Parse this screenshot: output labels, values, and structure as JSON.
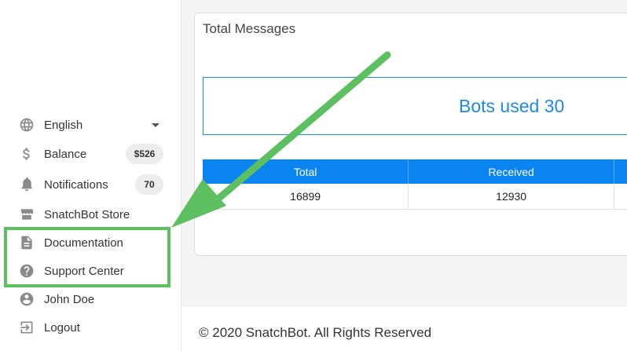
{
  "sidebar": {
    "language": {
      "label": "English",
      "icon": "globe-icon"
    },
    "balance": {
      "label": "Balance",
      "badge": "$526",
      "icon": "dollar-icon"
    },
    "notifications": {
      "label": "Notifications",
      "badge": "70",
      "icon": "bell-icon"
    },
    "store": {
      "label": "SnatchBot Store",
      "icon": "store-icon"
    },
    "documentation": {
      "label": "Documentation",
      "icon": "document-icon"
    },
    "support": {
      "label": "Support Center",
      "icon": "help-circle-icon"
    },
    "user": {
      "label": "John Doe",
      "icon": "user-icon"
    },
    "logout": {
      "label": "Logout",
      "icon": "logout-icon"
    }
  },
  "main": {
    "card_title": "Total Messages",
    "bots_used": "Bots used 30",
    "table": {
      "headers": [
        "Total",
        "Received",
        ""
      ],
      "rows": [
        [
          "16899",
          "12930",
          ""
        ]
      ]
    }
  },
  "footer": {
    "copyright": "© 2020 SnatchBot. All Rights Reserved"
  },
  "annotation": {
    "color": "#5cbf60"
  },
  "colors": {
    "accent": "#1e88e5",
    "table_header": "#0a84f0"
  }
}
